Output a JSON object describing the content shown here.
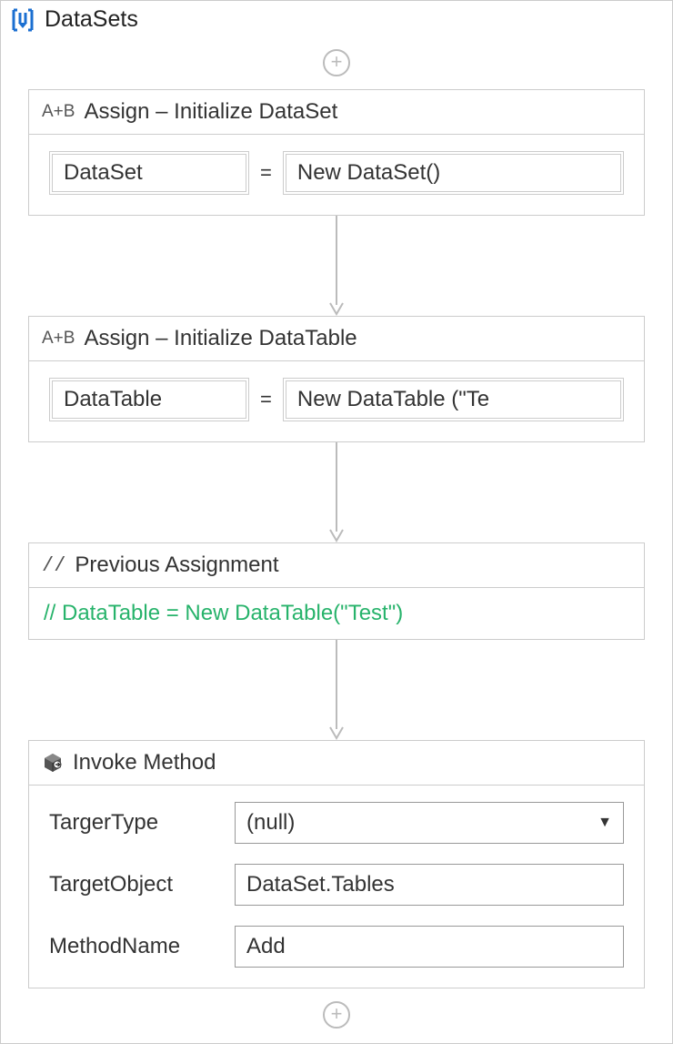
{
  "root": {
    "title": "DataSets"
  },
  "activities": {
    "assign1": {
      "badge": "A+B",
      "title": "Assign – Initialize DataSet",
      "lhs": "DataSet",
      "rhs": "New DataSet()"
    },
    "assign2": {
      "badge": "A+B",
      "title": "Assign – Initialize DataTable",
      "lhs": "DataTable",
      "rhs": "New DataTable (\"Te"
    },
    "comment": {
      "slashes": "//",
      "title": "Previous Assignment",
      "text": "// DataTable = New DataTable(\"Test\")"
    },
    "invoke": {
      "title": "Invoke Method",
      "targetTypeLabel": "TargerType",
      "targetTypeValue": "(null)",
      "targetObjectLabel": "TargetObject",
      "targetObjectValue": "DataSet.Tables",
      "methodNameLabel": "MethodName",
      "methodNameValue": "Add"
    }
  },
  "equals": "="
}
